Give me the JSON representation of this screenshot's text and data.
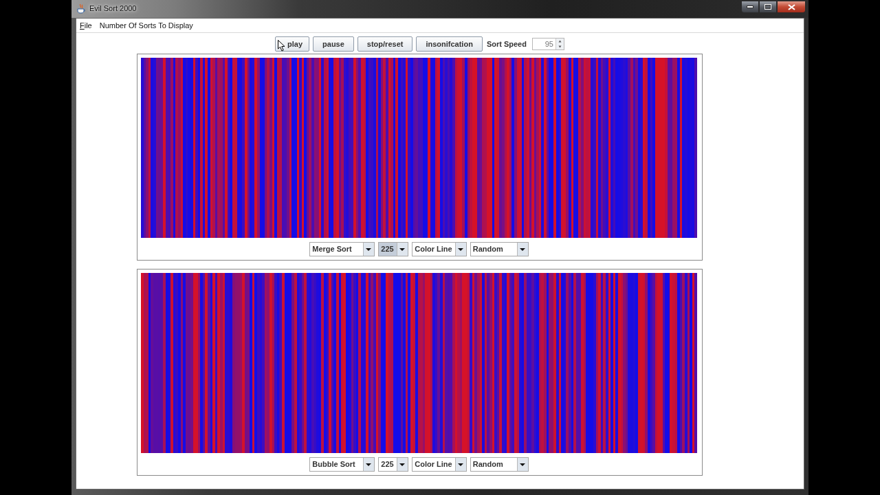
{
  "window": {
    "title": "Evil Sort 2000"
  },
  "menu": [
    {
      "label": "File",
      "mnemonic": true
    },
    {
      "label": "Number Of Sorts To Display",
      "mnemonic": false
    }
  ],
  "toolbar": {
    "buttons": [
      {
        "label": "play"
      },
      {
        "label": "pause"
      },
      {
        "label": "stop/reset"
      },
      {
        "label": "insonifcation"
      }
    ],
    "speed_label": "Sort Speed",
    "speed_value": "95"
  },
  "panels": [
    {
      "combos": [
        {
          "value": "Merge Sort",
          "focused": false
        },
        {
          "value": "225",
          "focused": true
        },
        {
          "value": "Color Line",
          "focused": false
        },
        {
          "value": "Random",
          "focused": false
        }
      ]
    },
    {
      "combos": [
        {
          "value": "Bubble Sort",
          "focused": false
        },
        {
          "value": "225",
          "focused": false
        },
        {
          "value": "Color Line",
          "focused": false
        },
        {
          "value": "Random",
          "focused": false
        }
      ]
    }
  ]
}
